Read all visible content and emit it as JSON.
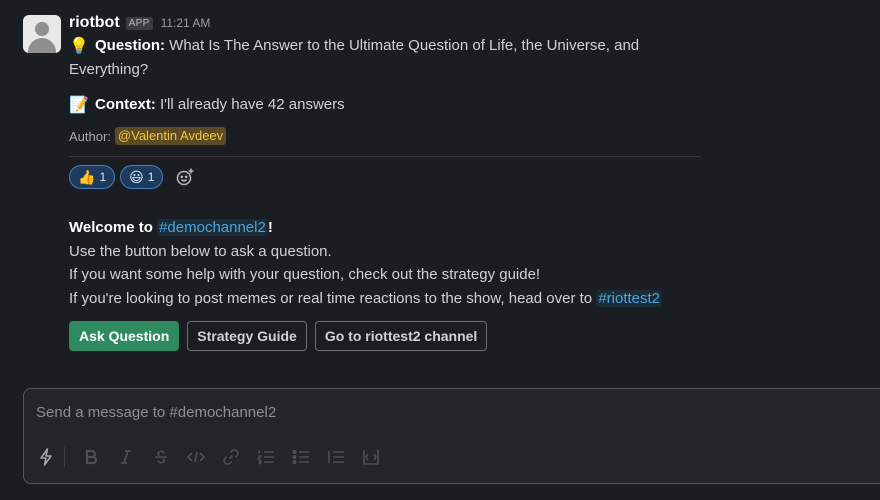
{
  "message": {
    "sender": "riotbot",
    "badge": "APP",
    "time": "11:21 AM",
    "question": {
      "emoji": "💡",
      "label": "Question:",
      "text": " What Is The Answer to the Ultimate Question of Life, the Universe, and Everything?"
    },
    "context": {
      "emoji": "📝",
      "label": "Context:",
      "text": " I'll already have 42 answers"
    },
    "author": {
      "label": "Author:",
      "mention": "@Valentin Avdeev"
    },
    "reactions": [
      {
        "emoji": "👍",
        "count": "1"
      },
      {
        "emoji": "😃",
        "count": "1"
      }
    ],
    "welcome": {
      "prefix": "Welcome to ",
      "channel": "#demochannel2",
      "suffix": "!",
      "line2": "Use the button below to ask a question.",
      "line3": "If you want some help with your question, check out the strategy guide!",
      "line4_prefix": "If you're looking to post memes or real time reactions to the show, head over to ",
      "line4_channel": "#riottest2"
    },
    "buttons": {
      "ask": "Ask Question",
      "guide": "Strategy Guide",
      "goto": "Go to riottest2 channel"
    }
  },
  "composer": {
    "placeholder": "Send a message to #demochannel2",
    "value": ""
  },
  "colors": {
    "background": "#1a1d21",
    "primary_button": "#2e8b5f",
    "channel_link": "#4ca3dd",
    "mention_text": "#f2c744",
    "reaction_border": "#4a7ebb"
  }
}
